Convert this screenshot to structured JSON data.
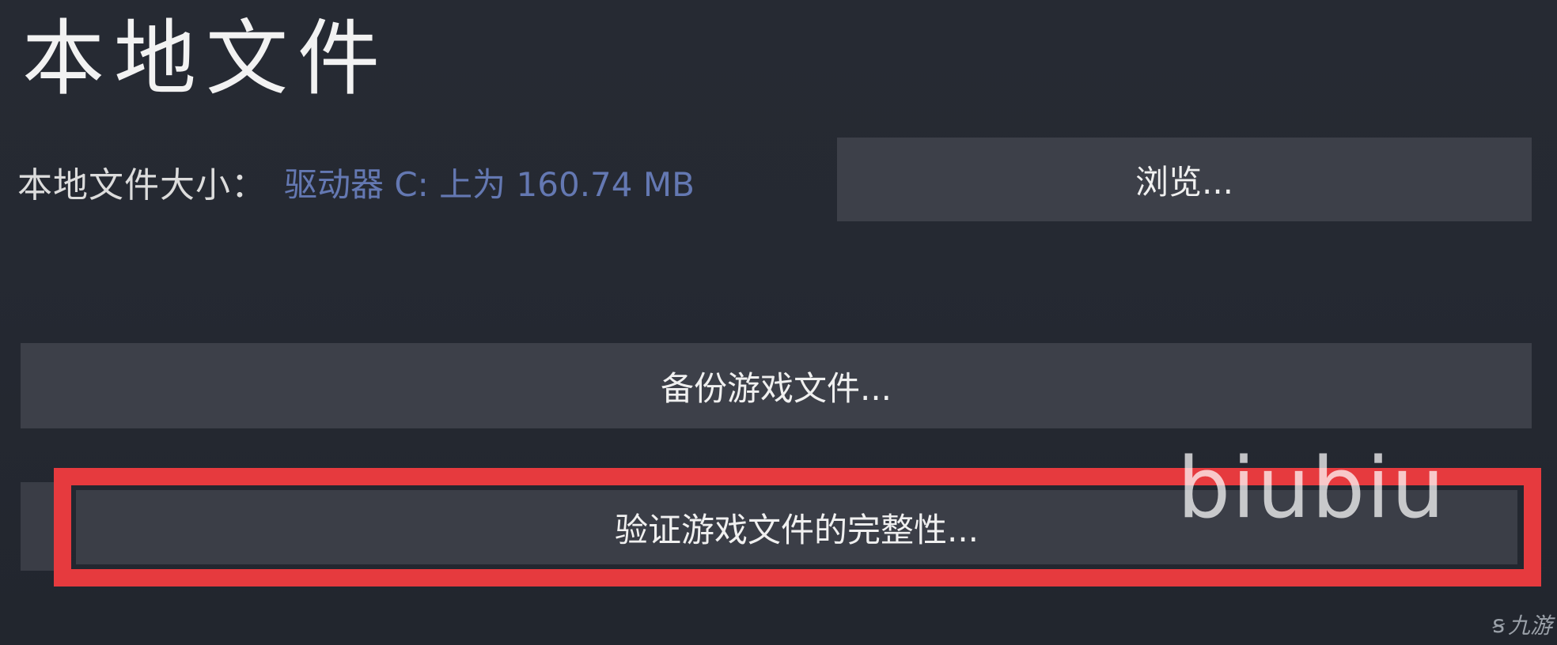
{
  "page_title": "本地文件",
  "size_row": {
    "label": "本地文件大小：",
    "value": "驱动器 C: 上为 160.74 MB"
  },
  "buttons": {
    "browse": "浏览...",
    "backup": "备份游戏文件...",
    "verify": "验证游戏文件的完整性..."
  },
  "watermark": "biubiu",
  "corner_logo": {
    "icon": "nine-game-logo-icon",
    "text": "九游"
  },
  "colors": {
    "background": "#252932",
    "button": "#3d4049",
    "highlight_outline": "#e63a3e",
    "size_value": "#6f86c9"
  }
}
